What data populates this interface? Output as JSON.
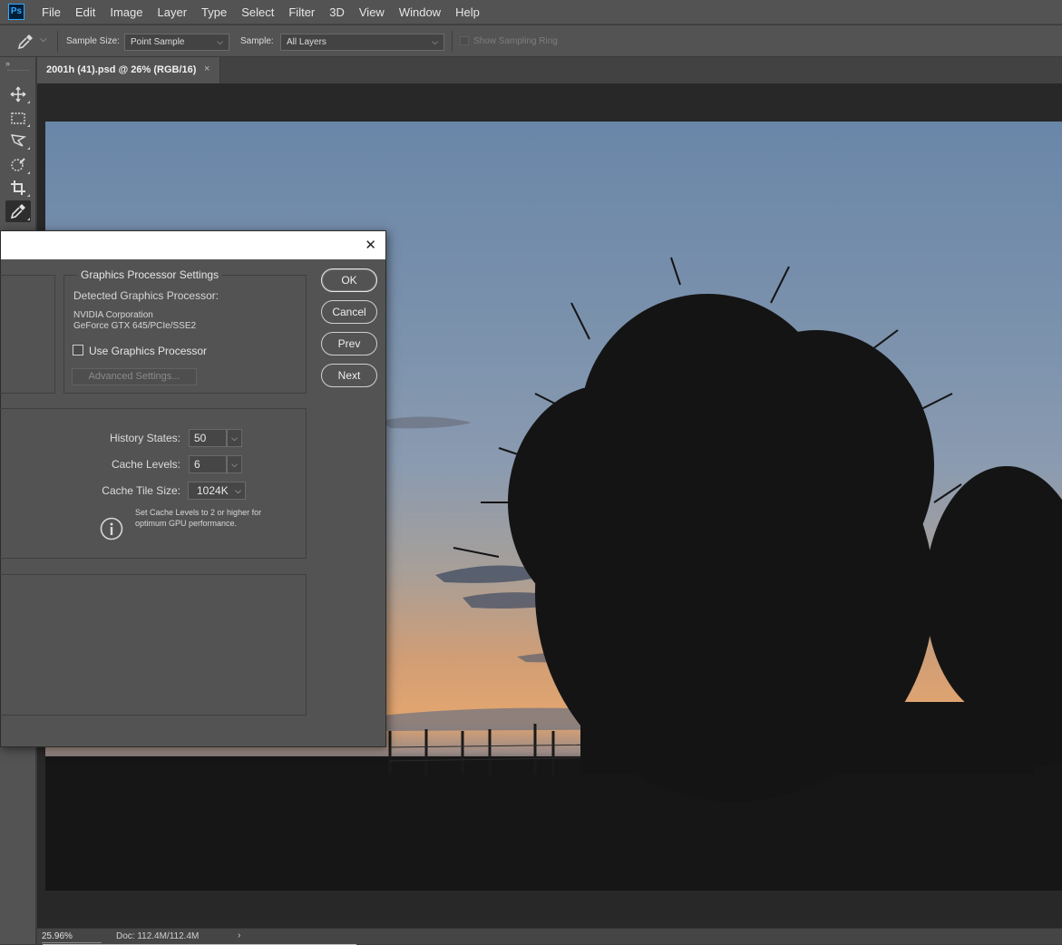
{
  "app": {
    "logo_text": "Ps"
  },
  "menu": [
    "File",
    "Edit",
    "Image",
    "Layer",
    "Type",
    "Select",
    "Filter",
    "3D",
    "View",
    "Window",
    "Help"
  ],
  "options_bar": {
    "sample_size_label": "Sample Size:",
    "sample_size_value": "Point Sample",
    "sample_label": "Sample:",
    "sample_value": "All Layers",
    "sampling_ring_label": "Show Sampling Ring"
  },
  "toolbar": {
    "collapse": "»",
    "tools": [
      "move-tool",
      "rectangular-marquee-tool",
      "lasso-tool",
      "quick-selection-tool",
      "crop-tool",
      "eyedropper-tool"
    ],
    "active_tool": "eyedropper-tool"
  },
  "document": {
    "tab_title": "2001h (41).psd @ 26% (RGB/16)",
    "close": "×"
  },
  "status": {
    "zoom": "25.96%",
    "doc_size": "Doc: 112.4M/112.4M",
    "arrow": "›"
  },
  "dialog": {
    "close": "✕",
    "gpu_group": {
      "title": "Graphics Processor Settings",
      "detected_label": "Detected Graphics Processor:",
      "vendor": "NVIDIA Corporation",
      "model": "GeForce GTX 645/PCIe/SSE2",
      "use_gpu_label": "Use Graphics Processor",
      "use_gpu_checked": false,
      "advanced_button": "Advanced Settings..."
    },
    "buttons": {
      "ok": "OK",
      "cancel": "Cancel",
      "prev": "Prev",
      "next": "Next"
    },
    "history_cache": {
      "history_states_label": "History States:",
      "history_states_value": "50",
      "cache_levels_label": "Cache Levels:",
      "cache_levels_value": "6",
      "cache_tile_size_label": "Cache Tile Size:",
      "cache_tile_size_value": "1024K",
      "info_line1": "Set Cache Levels to 2 or higher for",
      "info_line2": "optimum GPU performance."
    }
  },
  "colors": {
    "ui_panel": "#535353",
    "canvas_bg": "#282828",
    "sky_top": "#6f87a6",
    "sky_horizon": "#e0a36c",
    "silhouette": "#141414"
  }
}
